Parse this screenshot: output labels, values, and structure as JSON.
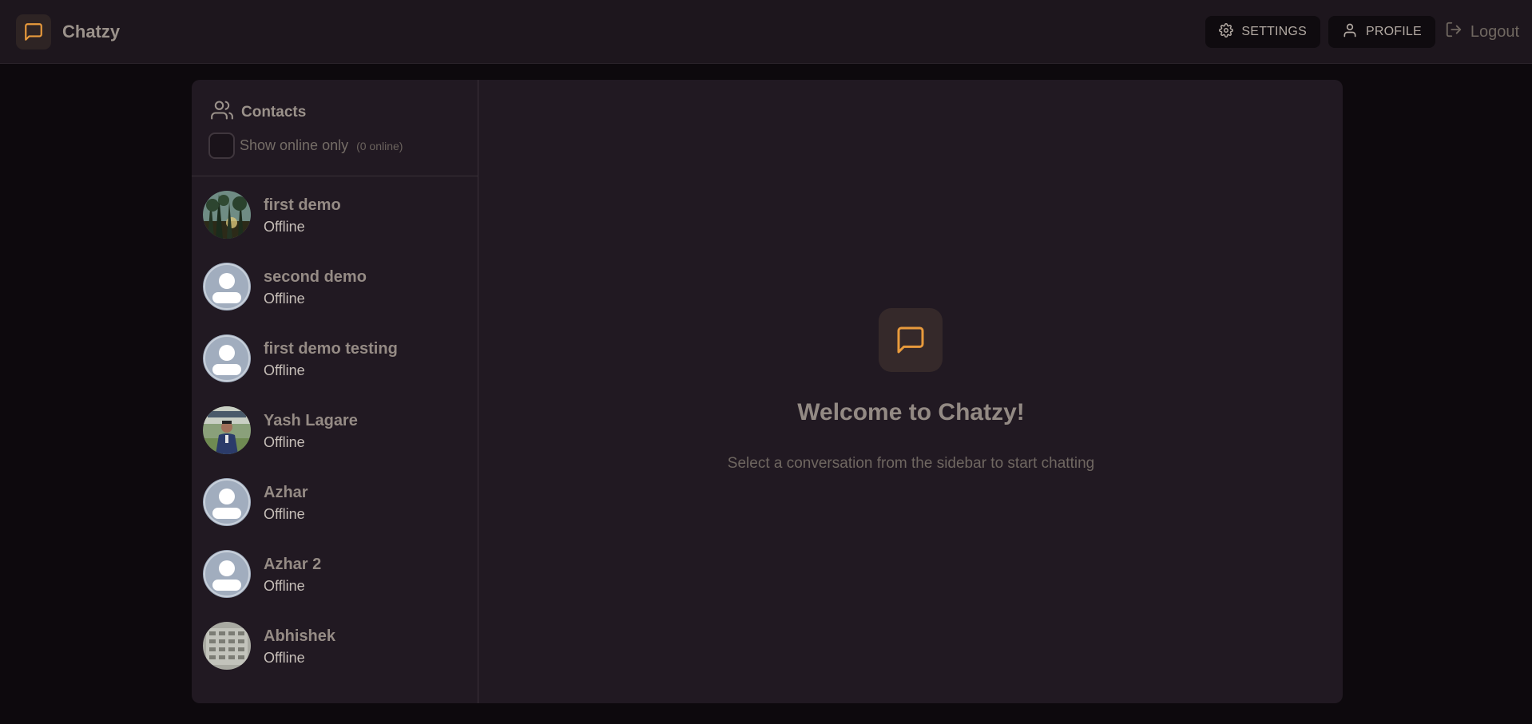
{
  "app": {
    "name": "Chatzy",
    "logo_icon": "message-square-icon",
    "accent_color": "#e89a3c"
  },
  "nav": {
    "settings_label": "SETTINGS",
    "profile_label": "PROFILE",
    "logout_label": "Logout"
  },
  "sidebar": {
    "title": "Contacts",
    "filter_label": "Show online only",
    "online_count": "(0 online)",
    "contacts": [
      {
        "name": "first demo",
        "status": "Offline",
        "avatar": "photo-trees"
      },
      {
        "name": "second demo",
        "status": "Offline",
        "avatar": "default-user"
      },
      {
        "name": "first demo testing",
        "status": "Offline",
        "avatar": "default-user"
      },
      {
        "name": "Yash Lagare",
        "status": "Offline",
        "avatar": "photo-person"
      },
      {
        "name": "Azhar",
        "status": "Offline",
        "avatar": "default-user"
      },
      {
        "name": "Azhar 2",
        "status": "Offline",
        "avatar": "default-user"
      },
      {
        "name": "Abhishek",
        "status": "Offline",
        "avatar": "photo-building"
      }
    ]
  },
  "welcome": {
    "title": "Welcome to Chatzy!",
    "subtitle": "Select a conversation from the sidebar to start chatting"
  }
}
